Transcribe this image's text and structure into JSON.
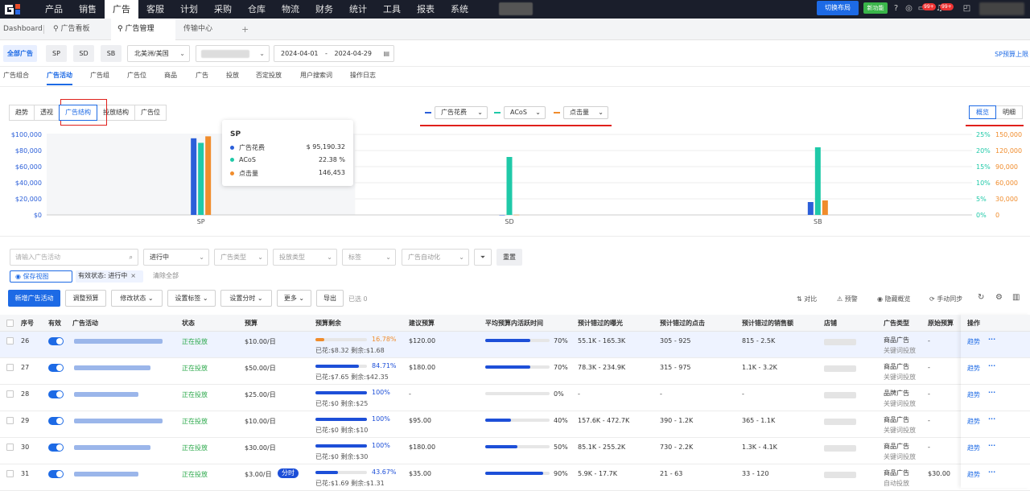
{
  "topbar": {
    "menu": [
      "产品",
      "销售",
      "广告",
      "客服",
      "计划",
      "采购",
      "仓库",
      "物流",
      "财务",
      "统计",
      "工具",
      "报表",
      "系统"
    ],
    "active_menu": "广告",
    "switch_layout": "切换布局",
    "new_feature": "新功能",
    "badge1": "99+",
    "badge2": "99+"
  },
  "tabs": {
    "t1": "Dashboard",
    "t2": "广告看板",
    "t3": "广告管理",
    "t4": "传输中心",
    "add": "+"
  },
  "filters": {
    "all": "全部广告",
    "sp": "SP",
    "sd": "SD",
    "sb": "SB",
    "region": "北美洲/美国",
    "date_start": "2024-04-01",
    "date_sep": "-",
    "date_end": "2024-04-29",
    "sp_budget": "SP预算上限"
  },
  "subtabs": [
    "广告组合",
    "广告活动",
    "广告组",
    "广告位",
    "商品",
    "广告",
    "投放",
    "否定投放",
    "用户搜索词",
    "操作日志"
  ],
  "active_subtab": "广告活动",
  "chart_controls": {
    "segments": [
      "趋势",
      "透视",
      "广告结构",
      "投放结构",
      "广告位"
    ],
    "active_segment": "广告结构",
    "legend_spend": "广告花费",
    "legend_acos": "ACoS",
    "legend_clicks": "点击量",
    "view_overview": "概览",
    "view_detail": "明细"
  },
  "chart_data": {
    "type": "bar",
    "categories": [
      "SP",
      "SD",
      "SB"
    ],
    "series": [
      {
        "name": "广告花费",
        "axis": "left",
        "color": "#2b5fd9",
        "values": [
          95190.32,
          0,
          16000
        ]
      },
      {
        "name": "ACoS",
        "axis": "right-percent",
        "color": "#1fc9a8",
        "values": [
          22.38,
          18,
          21
        ]
      },
      {
        "name": "点击量",
        "axis": "right-count",
        "color": "#f08c2c",
        "values": [
          146453,
          300,
          27000
        ]
      }
    ],
    "left_ticks": [
      "$100,000",
      "$80,000",
      "$60,000",
      "$40,000",
      "$20,000",
      "$0"
    ],
    "right_pct_ticks": [
      "25%",
      "20%",
      "15%",
      "10%",
      "5%",
      "0%"
    ],
    "right_cnt_ticks": [
      "150,000",
      "120,000",
      "90,000",
      "60,000",
      "30,000",
      "0"
    ],
    "ylim_left": [
      0,
      100000
    ],
    "ylim_pct": [
      0,
      25
    ],
    "ylim_cnt": [
      0,
      150000
    ]
  },
  "tooltip": {
    "title": "SP",
    "r1_label": "广告花费",
    "r1_val": "$ 95,190.32",
    "r2_label": "ACoS",
    "r2_val": "22.38 %",
    "r3_label": "点击量",
    "r3_val": "146,453"
  },
  "table_filters": {
    "search_placeholder": "请输入广告活动",
    "status": "进行中",
    "ad_type": "广告类型",
    "targeting_type": "投放类型",
    "tags": "标签",
    "automation": "广告自动化",
    "reset": "重置",
    "save_view": "保存视图",
    "active_chip": "有效状态: 进行中",
    "clear_all": "清除全部"
  },
  "actions": {
    "new_campaign": "新增广告活动",
    "adjust_budget": "调整预算",
    "change_status": "修改状态",
    "set_tags": "设置标签",
    "set_dayparting": "设置分时",
    "more": "更多",
    "export": "导出",
    "selected": "已选 0",
    "compare": "对比",
    "alert": "预警",
    "hide_overview": "隐藏概览",
    "manual_sync": "手动同步"
  },
  "table": {
    "headers": [
      "序号",
      "有效",
      "广告活动",
      "状态",
      "预算",
      "预算剩余",
      "建议预算",
      "平均预算内活跃时间",
      "预计错过的曝光",
      "预计错过的点击",
      "预计错过的销售额",
      "店铺",
      "广告类型",
      "原始预算",
      "操作"
    ],
    "rows": [
      {
        "no": "26",
        "status": "正在投放",
        "budget": "$10.00/日",
        "pct": "16.78%",
        "pctval": 16.78,
        "pctcolor": "#f08c2c",
        "spent": "已花:$8.32  剩余:$1.68",
        "suggest": "$120.00",
        "active_pct": "70%",
        "active_val": 70,
        "impr": "55.1K - 165.3K",
        "clicks": "305 - 925",
        "sales": "815 - 2.5K",
        "type": "商品广告",
        "subtype": "关键词投放",
        "orig": "-",
        "op": "趋势",
        "more": "···"
      },
      {
        "no": "27",
        "status": "正在投放",
        "budget": "$50.00/日",
        "pct": "84.71%",
        "pctval": 84.71,
        "pctcolor": "#1d4fd8",
        "spent": "已花:$7.65  剩余:$42.35",
        "suggest": "$180.00",
        "active_pct": "70%",
        "active_val": 70,
        "impr": "78.3K - 234.9K",
        "clicks": "315 - 975",
        "sales": "1.1K - 3.2K",
        "type": "商品广告",
        "subtype": "关键词投放",
        "orig": "-",
        "op": "趋势",
        "more": "···"
      },
      {
        "no": "28",
        "status": "正在投放",
        "budget": "$25.00/日",
        "pct": "100%",
        "pctval": 100,
        "pctcolor": "#1d4fd8",
        "spent": "已花:$0  剩余:$25",
        "suggest": "-",
        "active_pct": "0%",
        "active_val": 0,
        "impr": "-",
        "clicks": "-",
        "sales": "-",
        "type": "品牌广告",
        "subtype": "关键词投放",
        "orig": "-",
        "op": "趋势",
        "more": "···"
      },
      {
        "no": "29",
        "status": "正在投放",
        "budget": "$10.00/日",
        "pct": "100%",
        "pctval": 100,
        "pctcolor": "#1d4fd8",
        "spent": "已花:$0  剩余:$10",
        "suggest": "$95.00",
        "active_pct": "40%",
        "active_val": 40,
        "impr": "157.6K - 472.7K",
        "clicks": "390 - 1.2K",
        "sales": "365 - 1.1K",
        "type": "商品广告",
        "subtype": "关键词投放",
        "orig": "-",
        "op": "趋势",
        "more": "···"
      },
      {
        "no": "30",
        "status": "正在投放",
        "budget": "$30.00/日",
        "pct": "100%",
        "pctval": 100,
        "pctcolor": "#1d4fd8",
        "spent": "已花:$0  剩余:$30",
        "suggest": "$180.00",
        "active_pct": "50%",
        "active_val": 50,
        "impr": "85.1K - 255.2K",
        "clicks": "730 - 2.2K",
        "sales": "1.3K - 4.1K",
        "type": "商品广告",
        "subtype": "关键词投放",
        "orig": "-",
        "op": "趋势",
        "more": "···"
      },
      {
        "no": "31",
        "status": "正在投放",
        "budget": "$3.00/日",
        "tag": "分时",
        "pct": "43.67%",
        "pctval": 43.67,
        "pctcolor": "#1d4fd8",
        "spent": "已花:$1.69  剩余:$1.31",
        "suggest": "$35.00",
        "active_pct": "90%",
        "active_val": 90,
        "impr": "5.9K - 17.7K",
        "clicks": "21 - 63",
        "sales": "33 - 120",
        "type": "商品广告",
        "subtype": "自动投放",
        "orig": "$30.00",
        "op": "趋势",
        "more": "···"
      }
    ]
  }
}
